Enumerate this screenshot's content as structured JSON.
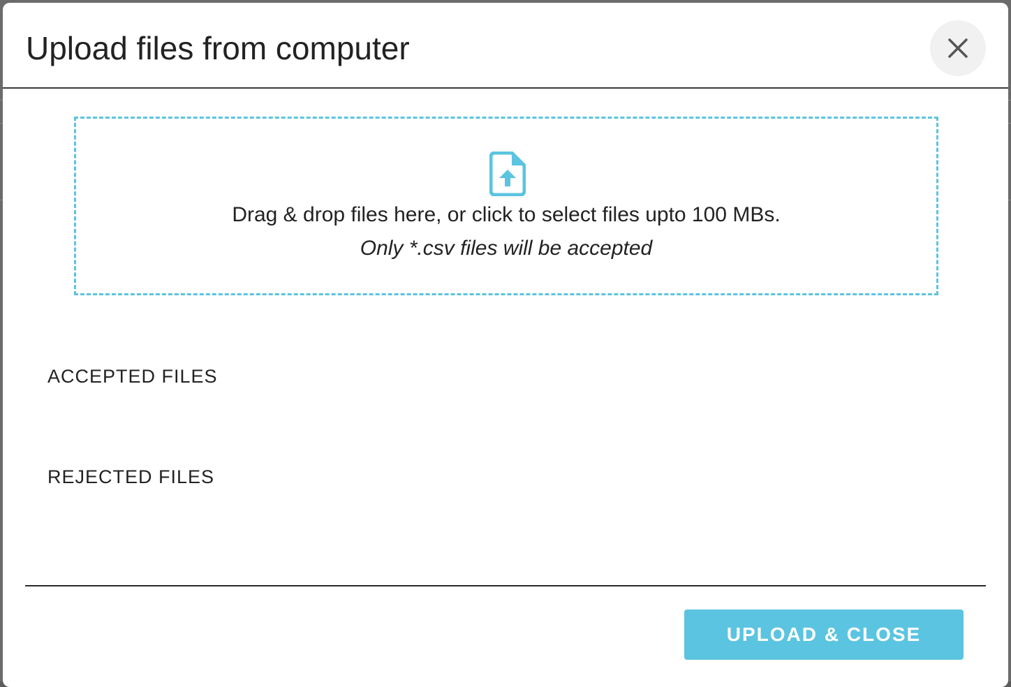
{
  "modal": {
    "title": "Upload files from computer",
    "close_icon": "close-icon"
  },
  "dropzone": {
    "icon": "file-upload-icon",
    "instruction": "Drag & drop files here, or click to select files upto 100 MBs.",
    "note": "Only *.csv files will be accepted"
  },
  "sections": {
    "accepted_label": "ACCEPTED FILES",
    "rejected_label": "REJECTED FILES"
  },
  "footer": {
    "upload_close_label": "UPLOAD & CLOSE"
  },
  "colors": {
    "accent": "#5bc4e0",
    "text": "#222222",
    "close_bg": "#f1f1f1"
  }
}
